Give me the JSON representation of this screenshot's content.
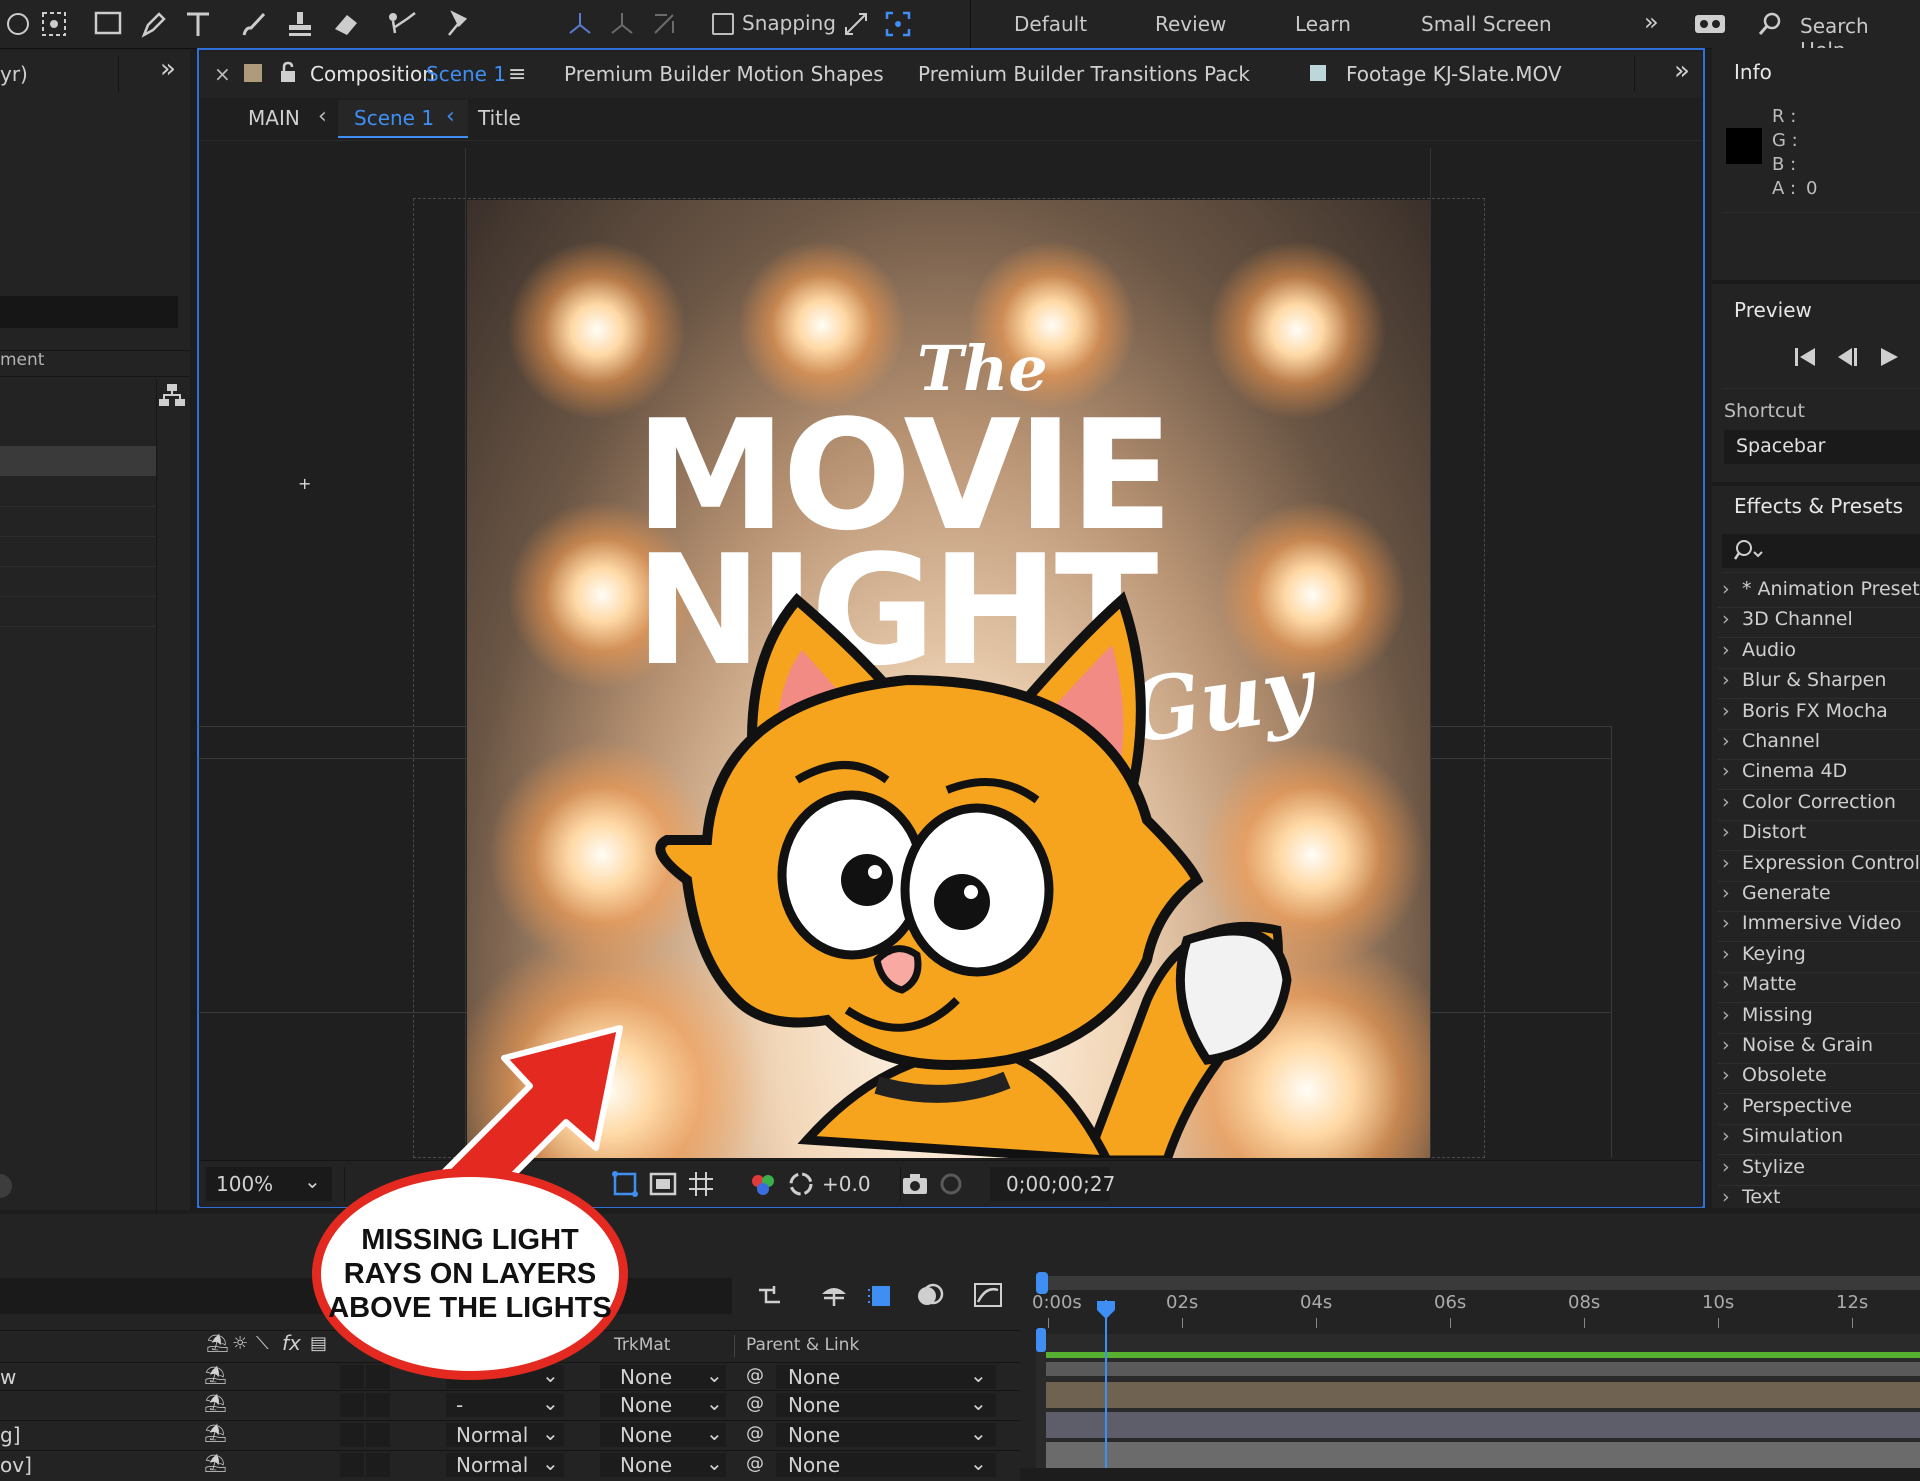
{
  "toolbar": {
    "snapping_label": "Snapping",
    "workspaces": [
      "Default",
      "Review",
      "Learn",
      "Small Screen"
    ],
    "search_label": "Search Help",
    "icons": [
      "rotate-icon",
      "camera-orbit-icon",
      "rectangle-icon",
      "pen-icon",
      "text-icon",
      "brush-icon",
      "stamp-icon",
      "eraser-icon",
      "roto-brush-icon",
      "puppet-pin-icon",
      "local-axis-icon",
      "world-axis-icon",
      "view-axis-icon",
      "snapping-checkbox-icon",
      "snap-options-icon",
      "snap-target-icon",
      "overflow-icon",
      "workspace-settings-icon",
      "search-icon"
    ]
  },
  "project_panel": {
    "title_fragment": "yr)",
    "col_fragment": "ment"
  },
  "composition_tabs": {
    "active_prefix": "Composition",
    "active_name": "Scene 1",
    "tab2": "Premium Builder Motion Shapes",
    "tab3": "Premium Builder Transitions Pack",
    "tab4": "Footage KJ-Slate.MOV"
  },
  "breadcrumbs": [
    "MAIN",
    "Scene 1",
    "Title"
  ],
  "viewer_footer": {
    "zoom": "100%",
    "exposure": "+0.0",
    "timecode": "0;00;00;27"
  },
  "composition_art": {
    "title_top": "The",
    "title_line1": "MOVIE",
    "title_line2": "NIGHT",
    "title_bottom": "Guy"
  },
  "info_panel": {
    "title": "Info",
    "r_label": "R :",
    "g_label": "G :",
    "b_label": "B :",
    "a_label": "A :",
    "a_value": "0"
  },
  "preview_panel": {
    "title": "Preview",
    "shortcut_label": "Shortcut",
    "shortcut_value": "Spacebar"
  },
  "effects_panel": {
    "title": "Effects & Presets",
    "items": [
      "* Animation Presets",
      "3D Channel",
      "Audio",
      "Blur & Sharpen",
      "Boris FX Mocha",
      "Channel",
      "Cinema 4D",
      "Color Correction",
      "Distort",
      "Expression Controls",
      "Generate",
      "Immersive Video",
      "Keying",
      "Matte",
      "Missing",
      "Noise & Grain",
      "Obsolete",
      "Perspective",
      "Simulation",
      "Stylize",
      "Text"
    ]
  },
  "timeline": {
    "col_trkmat": "TrkMat",
    "col_parent": "Parent & Link",
    "ruler": [
      "0:00s",
      "02s",
      "04s",
      "06s",
      "08s",
      "10s",
      "12s"
    ],
    "rows": [
      {
        "name": "w",
        "mode": "",
        "trkmat": "None",
        "parent": "None"
      },
      {
        "name": "",
        "mode": "-",
        "trkmat": "None",
        "parent": "None"
      },
      {
        "name": "g]",
        "mode": "Normal",
        "trkmat": "None",
        "parent": "None"
      },
      {
        "name": "ov]",
        "mode": "Normal",
        "trkmat": "None",
        "parent": "None"
      }
    ]
  },
  "annotation": {
    "callout_text": "MISSING LIGHT RAYS ON LAYERS ABOVE THE LIGHTS",
    "arrow_color": "#e42a20"
  },
  "colors": {
    "accent_blue": "#3f8ef3",
    "panel_bg": "#232323",
    "cat_orange": "#f6a31d"
  }
}
